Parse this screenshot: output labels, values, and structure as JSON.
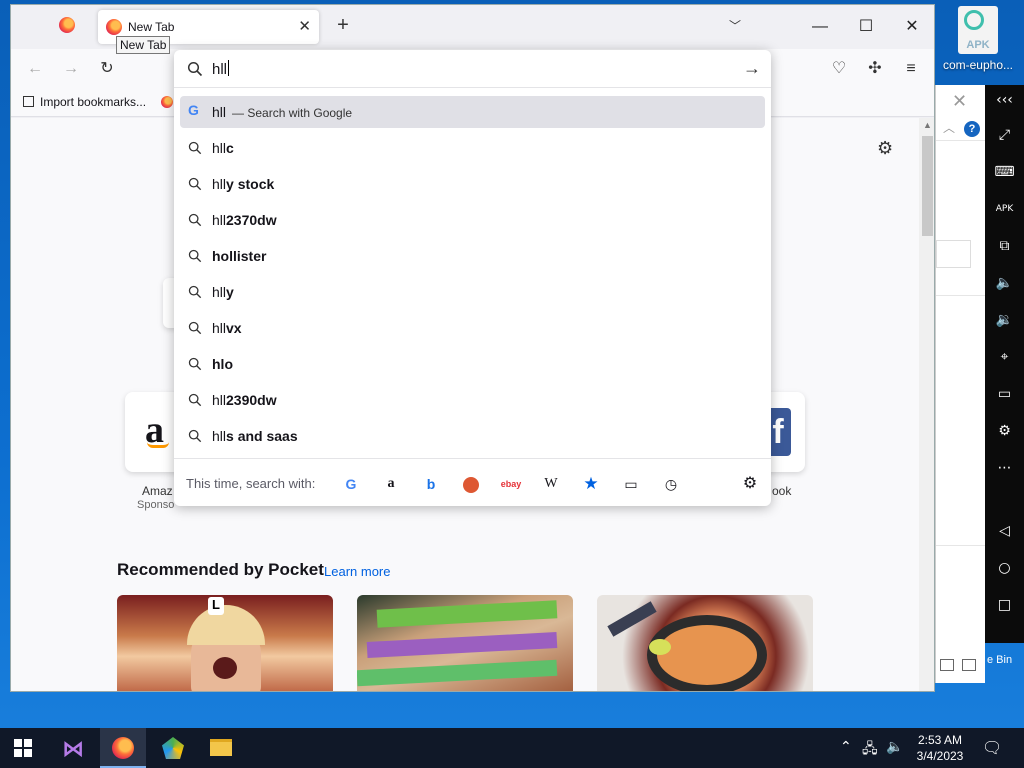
{
  "desktop": {
    "icon_label": "com-eupho...",
    "apk_text": "APK",
    "bin_label": "e Bin"
  },
  "browser": {
    "tab": {
      "title": "New Tab",
      "tooltip": "New Tab"
    },
    "url": {
      "value": "hll"
    },
    "bookmarks": {
      "import_label": "Import bookmarks..."
    },
    "suggestions": [
      {
        "typed": "hll",
        "bold": "",
        "action": "— Search with Google",
        "engine_icon": "google-icon"
      },
      {
        "typed": "hll",
        "bold": "c"
      },
      {
        "typed": "hll",
        "bold": "y stock"
      },
      {
        "typed": "hll",
        "bold": "2370dw"
      },
      {
        "typed": "",
        "bold": "hollister"
      },
      {
        "typed": "hll",
        "bold": "y"
      },
      {
        "typed": "hll",
        "bold": "vx"
      },
      {
        "typed": "",
        "bold": "hlo"
      },
      {
        "typed": "hll",
        "bold": "2390dw"
      },
      {
        "typed": "hll",
        "bold": "s and saas"
      }
    ],
    "oneoff": {
      "label": "This time, search with:",
      "engines": [
        "google-icon",
        "amazon-icon",
        "bing-icon",
        "duckduckgo-icon",
        "ebay-icon",
        "wikipedia-icon",
        "bookmarks-star-icon",
        "tabs-icon",
        "history-clock-icon"
      ]
    },
    "shortcuts": [
      {
        "label": "Amaz",
        "sponsored": "Sponso"
      },
      {
        "label": "ook",
        "sponsored": ""
      }
    ],
    "pocket": {
      "title": "Recommended by Pocket",
      "learn_more": "Learn more"
    }
  },
  "taskbar": {
    "time": "2:53 AM",
    "date": "3/4/2023"
  },
  "colors": {
    "accent": "#0061e0",
    "desktop": "#0d6fd0",
    "taskbar": "#101828"
  }
}
